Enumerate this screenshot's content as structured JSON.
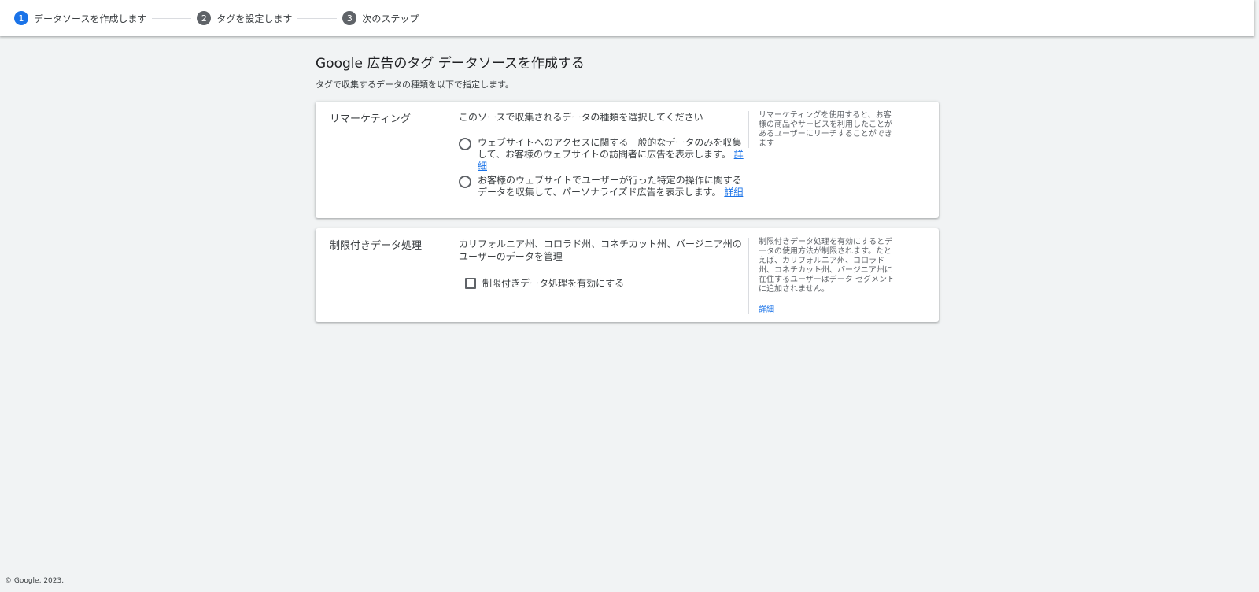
{
  "stepper": {
    "steps": [
      {
        "num": "1",
        "label": "データソースを作成します"
      },
      {
        "num": "2",
        "label": "タグを設定します"
      },
      {
        "num": "3",
        "label": "次のステップ"
      }
    ]
  },
  "page": {
    "title": "Google 広告のタグ データソースを作成する",
    "subtitle": "タグで収集するデータの種類を以下で指定します。"
  },
  "remarketing": {
    "title": "リマーケティング",
    "question": "このソースで収集されるデータの種類を選択してください",
    "option1_text": "ウェブサイトへのアクセスに関する一般的なデータのみを収集して、お客様のウェブサイトの訪問者に広告を表示します。",
    "option1_link": "詳細",
    "option2_text": "お客様のウェブサイトでユーザーが行った特定の操作に関するデータを収集して、パーソナライズド広告を表示します。",
    "option2_link": "詳細",
    "help": "リマーケティングを使用すると、お客様の商品やサービスを利用したことがあるユーザーにリーチすることができます"
  },
  "restricted": {
    "title": "制限付きデータ処理",
    "description": "カリフォルニア州、コロラド州、コネチカット州、バージニア州のユーザーのデータを管理",
    "checkbox_label": "制限付きデータ処理を有効にする",
    "help": "制限付きデータ処理を有効にするとデータの使用方法が制限されます。たとえば、カリフォルニア州、コロラド州、コネチカット州、バージニア州に在住するユーザーはデータ セグメントに追加されません。",
    "help_link": "詳細"
  },
  "footer": {
    "copyright": "© Google, 2023."
  },
  "colors": {
    "accent": "#1a73e8",
    "background": "#f1f3f4"
  }
}
